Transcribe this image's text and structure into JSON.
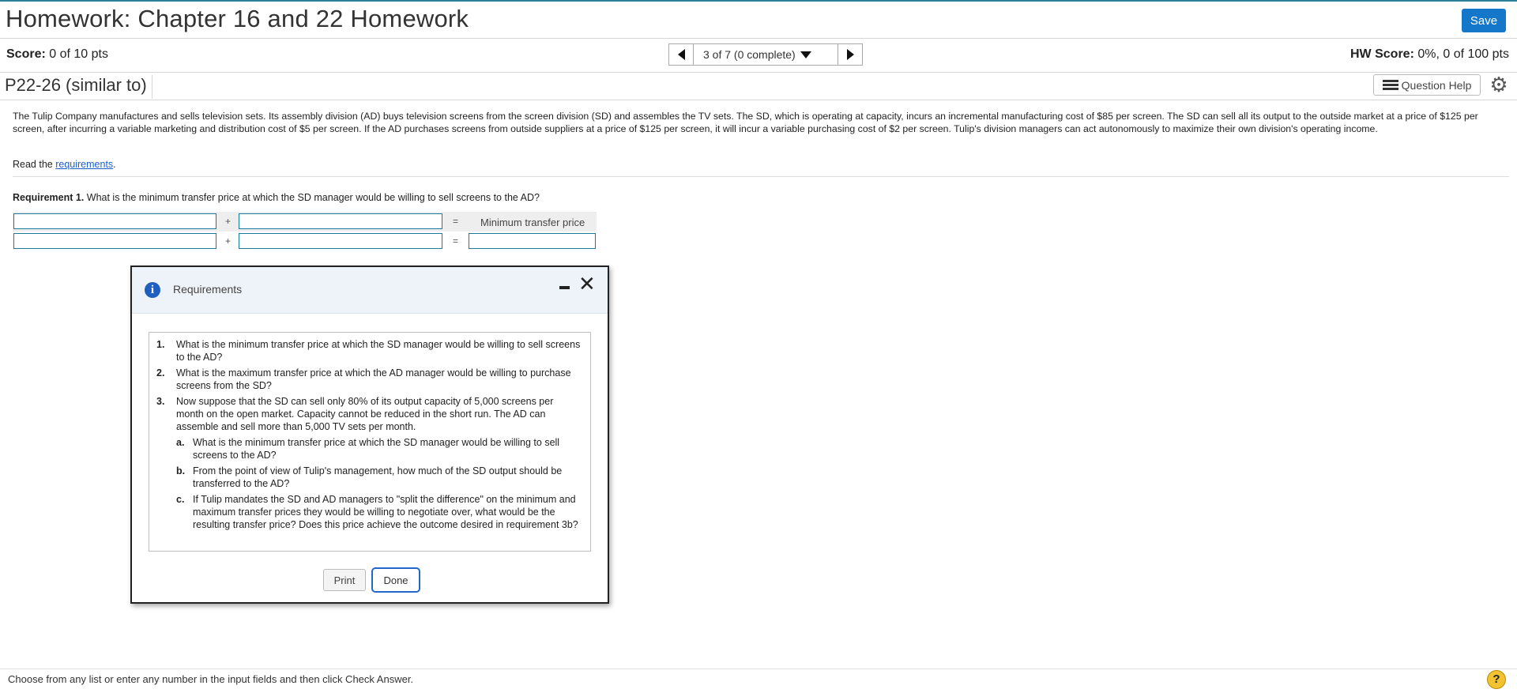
{
  "header": {
    "title": "Homework: Chapter 16 and 22 Homework",
    "save_label": "Save"
  },
  "score": {
    "label": "Score:",
    "value": "0 of 10 pts",
    "hw_label": "HW Score:",
    "hw_value": "0%, 0 of 100 pts"
  },
  "nav": {
    "position": "3 of 7 (0 complete)"
  },
  "question": {
    "id": "P22-26 (similar to)",
    "help_label": "Question Help"
  },
  "problem": {
    "text": "The Tulip Company manufactures and sells television sets. Its assembly division (AD) buys television screens from the screen division (SD) and assembles the TV sets. The SD, which is operating at capacity, incurs an incremental manufacturing cost of $85 per screen. The SD can sell all its output to the outside market at a price of $125 per screen, after incurring a variable marketing and distribution cost of $5 per screen. If the AD purchases screens from outside suppliers at a price of $125 per screen, it will incur a variable purchasing cost of $2 per screen. Tulip's division managers can act autonomously to maximize their own division's operating income.",
    "read_prefix": "Read the ",
    "read_link": "requirements",
    "read_suffix": "."
  },
  "requirement1": {
    "label": "Requirement 1.",
    "question": " What is the minimum transfer price at which the SD manager would be willing to sell screens to the AD?",
    "plus": "+",
    "equals": "=",
    "result_header": "Minimum transfer price"
  },
  "modal": {
    "title": "Requirements",
    "items": [
      {
        "num": "1.",
        "text": "What is the minimum transfer price at which the SD manager would be willing to sell screens to the AD?"
      },
      {
        "num": "2.",
        "text": "What is the maximum transfer price at which the AD manager would be willing to purchase screens from the SD?"
      },
      {
        "num": "3.",
        "text": "Now suppose that the SD can sell only 80% of its output capacity of 5,000 screens per month on the open market. Capacity cannot be reduced in the short run. The AD can assemble and sell more than 5,000 TV sets per month."
      }
    ],
    "subitems": [
      {
        "num": "a.",
        "text": "What is the minimum transfer price at which the SD manager would be willing to sell screens to the AD?"
      },
      {
        "num": "b.",
        "text": "From the point of view of Tulip's management, how much of the SD output should be transferred to the AD?"
      },
      {
        "num": "c.",
        "text": "If Tulip mandates the SD and AD managers to \"split the difference\" on the minimum and maximum transfer prices they would be willing to negotiate over, what would be the resulting transfer price? Does this price achieve the outcome desired in requirement 3b?"
      }
    ],
    "print_label": "Print",
    "done_label": "Done"
  },
  "footer": {
    "text": "Choose from any list or enter any number in the input fields and then click Check Answer.",
    "help_glyph": "?"
  },
  "colors": {
    "accent": "#1577c9",
    "input_border": "#1a7a9a",
    "link": "#1a5fcf"
  },
  "icons": [
    "chevron-left-icon",
    "chevron-right-icon",
    "caret-down-icon",
    "list-icon",
    "gear-icon",
    "info-icon",
    "minimize-icon",
    "close-icon",
    "help-icon"
  ]
}
